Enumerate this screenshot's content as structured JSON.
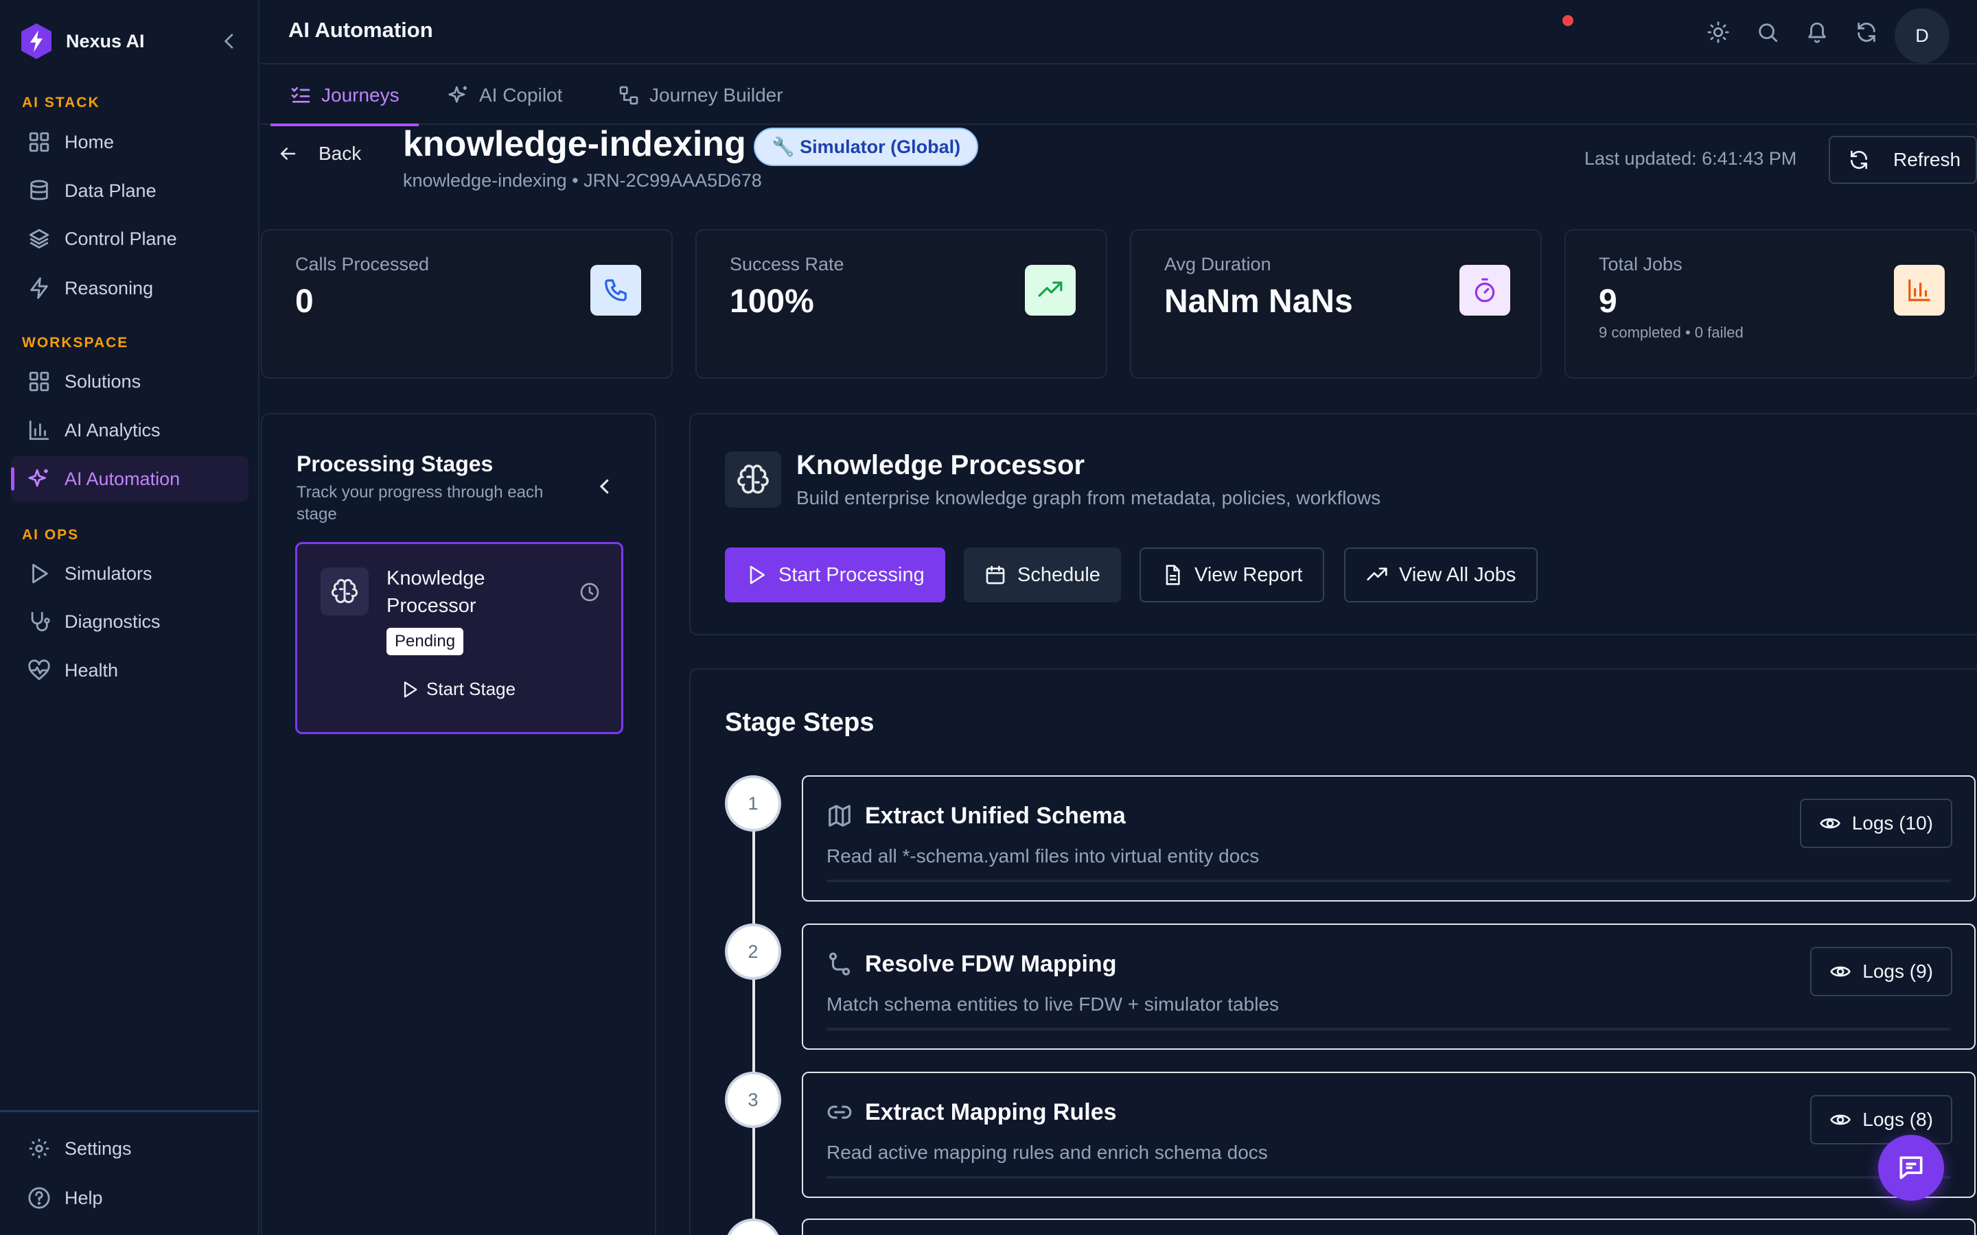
{
  "app": {
    "name": "Nexus AI"
  },
  "sidebar": {
    "sections": [
      {
        "label": "AI STACK",
        "items": [
          "Home",
          "Data Plane",
          "Control Plane",
          "Reasoning"
        ]
      },
      {
        "label": "WORKSPACE",
        "items": [
          "Solutions",
          "AI Analytics",
          "AI Automation"
        ]
      },
      {
        "label": "AI OPS",
        "items": [
          "Simulators",
          "Diagnostics",
          "Health"
        ]
      }
    ],
    "active_item": "AI Automation",
    "footer": [
      "Settings",
      "Help"
    ],
    "icons": {
      "home": "grid-icon",
      "data_plane": "database-icon",
      "control_plane": "layers-icon",
      "reasoning": "lightning-icon",
      "solutions": "grid-icon",
      "ai_analytics": "bar-chart-icon",
      "ai_automation": "sparkles-icon",
      "simulators": "play-icon",
      "diagnostics": "stethoscope-icon",
      "health": "heart-pulse-icon",
      "settings": "gear-icon",
      "help": "help-circle-icon"
    }
  },
  "header": {
    "title": "AI Automation",
    "avatar_initial": "D",
    "icons": [
      "sun-icon",
      "search-icon",
      "bell-icon",
      "refresh-icon"
    ]
  },
  "tabs": [
    {
      "label": "Journeys",
      "icon": "list-checks-icon",
      "active": true
    },
    {
      "label": "AI Copilot",
      "icon": "sparkles-icon",
      "active": false
    },
    {
      "label": "Journey Builder",
      "icon": "workflow-icon",
      "active": false
    }
  ],
  "page": {
    "back_label": "Back",
    "title": "knowledge-indexing",
    "badge": "🔧 Simulator (Global)",
    "subtitle": "knowledge-indexing • JRN-2C99AAA5D678",
    "last_updated": "Last updated: 6:41:43 PM",
    "refresh_label": "Refresh"
  },
  "stats": [
    {
      "label": "Calls Processed",
      "value": "0",
      "sub": "",
      "icon": "phone-icon",
      "color": "#2563eb",
      "bg": "#dbeafe"
    },
    {
      "label": "Success Rate",
      "value": "100%",
      "sub": "",
      "icon": "trending-up-icon",
      "color": "#16a34a",
      "bg": "#dcfce7"
    },
    {
      "label": "Avg Duration",
      "value": "NaNm NaNs",
      "sub": "",
      "icon": "timer-icon",
      "color": "#9333ea",
      "bg": "#f3e8ff"
    },
    {
      "label": "Total Jobs",
      "value": "9",
      "sub": "9 completed • 0 failed",
      "icon": "bar-chart-icon",
      "color": "#ea580c",
      "bg": "#ffedd5"
    }
  ],
  "stages": {
    "title": "Processing Stages",
    "description": "Track your progress through each stage",
    "items": [
      {
        "name": "Knowledge Processor",
        "status": "Pending",
        "action": "Start Stage",
        "icon": "brain-icon"
      }
    ]
  },
  "detail": {
    "title": "Knowledge Processor",
    "description": "Build enterprise knowledge graph from metadata, policies, workflows",
    "actions": [
      "Start Processing",
      "Schedule",
      "View Report",
      "View All Jobs"
    ]
  },
  "steps": {
    "title": "Stage Steps",
    "items": [
      {
        "number": "1",
        "title": "Extract Unified Schema",
        "description": "Read all *-schema.yaml files into virtual entity docs",
        "logs": "Logs (10)",
        "icon": "map-icon"
      },
      {
        "number": "2",
        "title": "Resolve FDW Mapping",
        "description": "Match schema entities to live FDW + simulator tables",
        "logs": "Logs (9)",
        "icon": "route-icon"
      },
      {
        "number": "3",
        "title": "Extract Mapping Rules",
        "description": "Read active mapping rules and enrich schema docs",
        "logs": "Logs (8)",
        "icon": "link-icon"
      }
    ]
  },
  "colors": {
    "accent": "#7c3aed",
    "accent_text": "#c084fc",
    "section_label": "#f59e0b",
    "background": "#0f172a"
  }
}
